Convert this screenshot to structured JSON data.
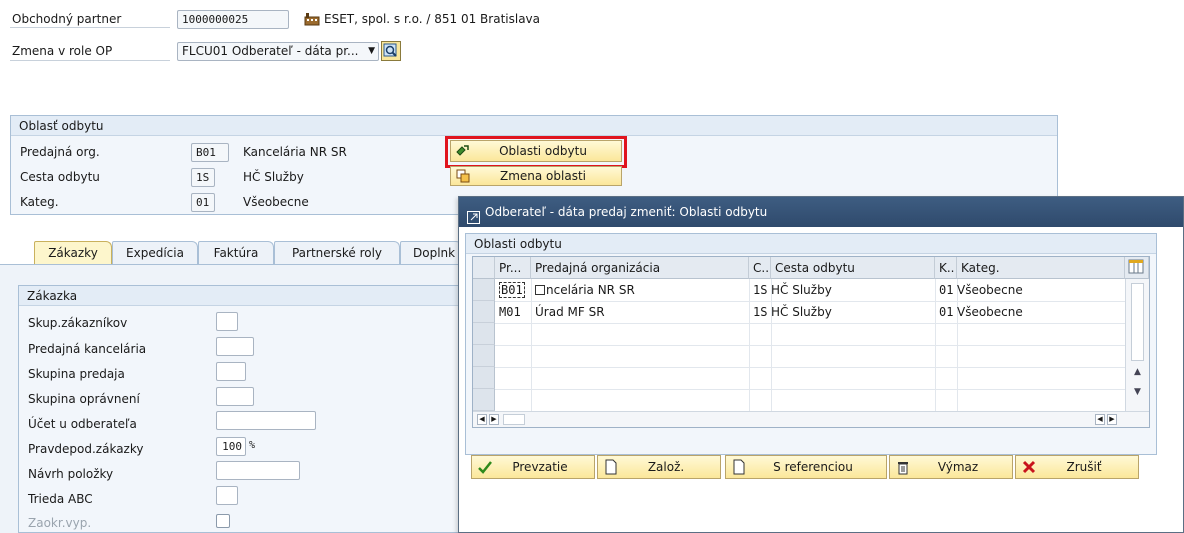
{
  "header": {
    "partner_label": "Obchodný partner",
    "partner_value": "1000000025",
    "partner_desc": "ESET, spol. s r.o. / 851 01 Bratislava",
    "role_label": "Zmena v role OP",
    "role_value": "FLCU01 Odberateľ - dáta pr..."
  },
  "sales_area": {
    "title": "Oblasť odbytu",
    "rows": [
      {
        "label": "Predajná org.",
        "code": "B01",
        "text": "Kancelária NR SR"
      },
      {
        "label": "Cesta odbytu",
        "code": "1S",
        "text": "HČ Služby"
      },
      {
        "label": "Kateg.",
        "code": "01",
        "text": "Všeobecne"
      }
    ],
    "btn_areas": "Oblasti odbytu",
    "btn_change": "Zmena oblasti"
  },
  "tabs": [
    {
      "label": "Zákazky"
    },
    {
      "label": "Expedícia"
    },
    {
      "label": "Faktúra"
    },
    {
      "label": "Partnerské roly"
    },
    {
      "label": "Doplnk"
    }
  ],
  "order": {
    "title": "Zákazka",
    "fields": [
      {
        "label": "Skup.zákazníkov",
        "value": ""
      },
      {
        "label": "Predajná kancelária",
        "value": ""
      },
      {
        "label": "Skupina predaja",
        "value": ""
      },
      {
        "label": "Skupina oprávnení",
        "value": ""
      },
      {
        "label": "Účet u odberateľa",
        "value": ""
      },
      {
        "label": "Pravdepod.zákazky",
        "value": "100",
        "unit": "%"
      },
      {
        "label": "Návrh položky",
        "value": ""
      },
      {
        "label": "Trieda ABC",
        "value": ""
      },
      {
        "label": "Zaokr.vyp.",
        "value": ""
      }
    ]
  },
  "dialog": {
    "title": "Odberateľ - dáta predaj zmeniť: Oblasti odbytu",
    "group_title": "Oblasti odbytu",
    "columns": [
      "Pr...",
      "Predajná organizácia",
      "C..",
      "Cesta odbytu",
      "K..",
      "Kateg."
    ],
    "rows": [
      {
        "org": "B01",
        "org_name": "ncelária NR SR",
        "channel": "1S",
        "channel_name": "HČ Služby",
        "div": "01",
        "div_name": "Všeobecne"
      },
      {
        "org": "M01",
        "org_name": "Úrad MF SR",
        "channel": "1S",
        "channel_name": "HČ Služby",
        "div": "01",
        "div_name": "Všeobecne"
      }
    ],
    "buttons": {
      "accept": "Prevzatie",
      "create": "Založ.",
      "with_ref": "S referenciou",
      "delete": "Výmaz",
      "cancel": "Zrušiť"
    }
  },
  "colors": {
    "highlight": "#e0141e",
    "title_bar": "#2f4a6c",
    "button": "#fbe79a"
  }
}
